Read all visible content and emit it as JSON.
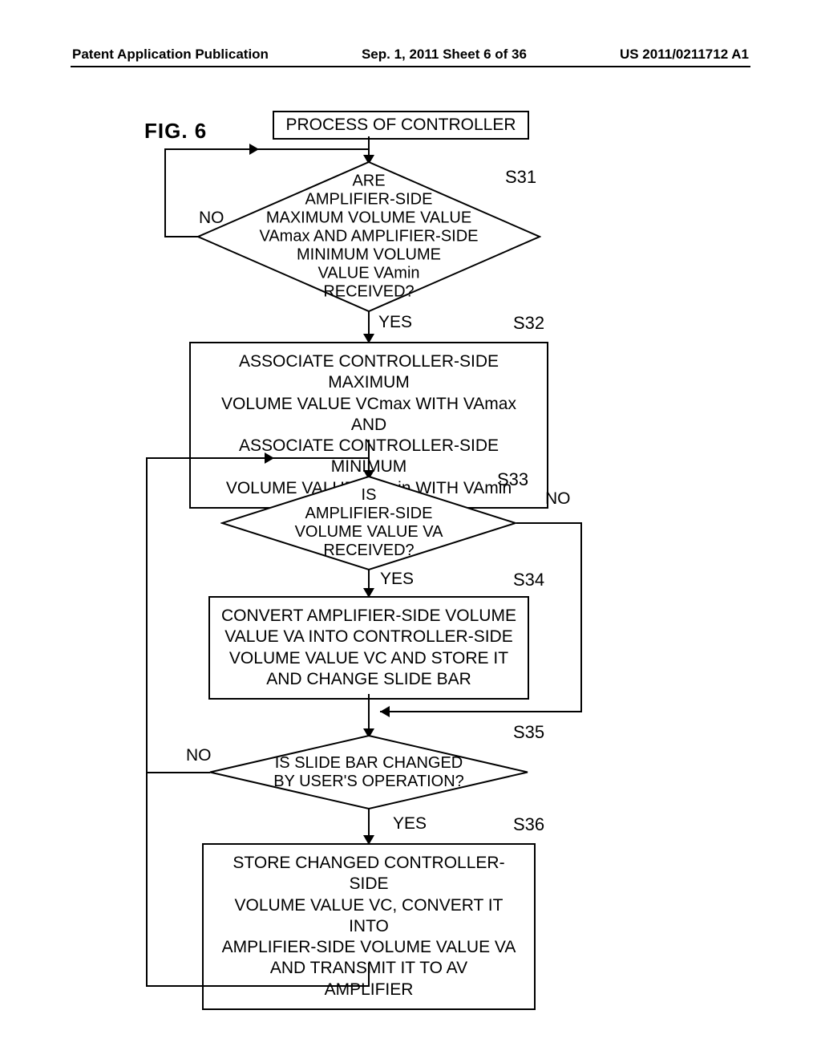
{
  "header": {
    "left": "Patent Application Publication",
    "center": "Sep. 1, 2011  Sheet 6 of 36",
    "right": "US 2011/0211712 A1"
  },
  "figure_label": "FIG.  6",
  "start": "PROCESS OF CONTROLLER",
  "steps": {
    "s31": {
      "label": "S31",
      "text": "ARE\nAMPLIFIER-SIDE\nMAXIMUM VOLUME VALUE\nVAmax AND AMPLIFIER-SIDE\nMINIMUM VOLUME\nVALUE VAmin\nRECEIVED?"
    },
    "s32": {
      "label": "S32",
      "text": "ASSOCIATE CONTROLLER-SIDE MAXIMUM\nVOLUME VALUE VCmax WITH VAmax AND\nASSOCIATE CONTROLLER-SIDE MINIMUM\nVOLUME VALUE VCmin WITH VAmin"
    },
    "s33": {
      "label": "S33",
      "text": "IS\nAMPLIFIER-SIDE\nVOLUME VALUE VA\nRECEIVED?"
    },
    "s34": {
      "label": "S34",
      "text": "CONVERT AMPLIFIER-SIDE VOLUME\nVALUE VA INTO CONTROLLER-SIDE\nVOLUME VALUE VC AND STORE IT\nAND CHANGE SLIDE BAR"
    },
    "s35": {
      "label": "S35",
      "text": "IS SLIDE BAR CHANGED\nBY USER'S OPERATION?"
    },
    "s36": {
      "label": "S36",
      "text": "STORE CHANGED CONTROLLER-SIDE\nVOLUME VALUE VC, CONVERT IT INTO\nAMPLIFIER-SIDE VOLUME VALUE VA\nAND TRANSMIT IT TO AV\nAMPLIFIER"
    }
  },
  "branches": {
    "yes": "YES",
    "no": "NO"
  },
  "chart_data": {
    "type": "flowchart",
    "nodes": [
      {
        "id": "start",
        "kind": "terminator",
        "text": "PROCESS OF CONTROLLER"
      },
      {
        "id": "S31",
        "kind": "decision",
        "text": "ARE AMPLIFIER-SIDE MAXIMUM VOLUME VALUE VAmax AND AMPLIFIER-SIDE MINIMUM VOLUME VALUE VAmin RECEIVED?"
      },
      {
        "id": "S32",
        "kind": "process",
        "text": "ASSOCIATE CONTROLLER-SIDE MAXIMUM VOLUME VALUE VCmax WITH VAmax AND ASSOCIATE CONTROLLER-SIDE MINIMUM VOLUME VALUE VCmin WITH VAmin"
      },
      {
        "id": "S33",
        "kind": "decision",
        "text": "IS AMPLIFIER-SIDE VOLUME VALUE VA RECEIVED?"
      },
      {
        "id": "S34",
        "kind": "process",
        "text": "CONVERT AMPLIFIER-SIDE VOLUME VALUE VA INTO CONTROLLER-SIDE VOLUME VALUE VC AND STORE IT AND CHANGE SLIDE BAR"
      },
      {
        "id": "S35",
        "kind": "decision",
        "text": "IS SLIDE BAR CHANGED BY USER'S OPERATION?"
      },
      {
        "id": "S36",
        "kind": "process",
        "text": "STORE CHANGED CONTROLLER-SIDE VOLUME VALUE VC, CONVERT IT INTO AMPLIFIER-SIDE VOLUME VALUE VA AND TRANSMIT IT TO AV AMPLIFIER"
      }
    ],
    "edges": [
      {
        "from": "start",
        "to": "S31"
      },
      {
        "from": "S31",
        "to": "S32",
        "label": "YES"
      },
      {
        "from": "S31",
        "to": "S31",
        "label": "NO"
      },
      {
        "from": "S32",
        "to": "S33"
      },
      {
        "from": "S33",
        "to": "S34",
        "label": "YES"
      },
      {
        "from": "S33",
        "to": "S35",
        "label": "NO"
      },
      {
        "from": "S34",
        "to": "S35"
      },
      {
        "from": "S35",
        "to": "S36",
        "label": "YES"
      },
      {
        "from": "S35",
        "to": "S33",
        "label": "NO"
      },
      {
        "from": "S36",
        "to": "S33"
      }
    ]
  }
}
